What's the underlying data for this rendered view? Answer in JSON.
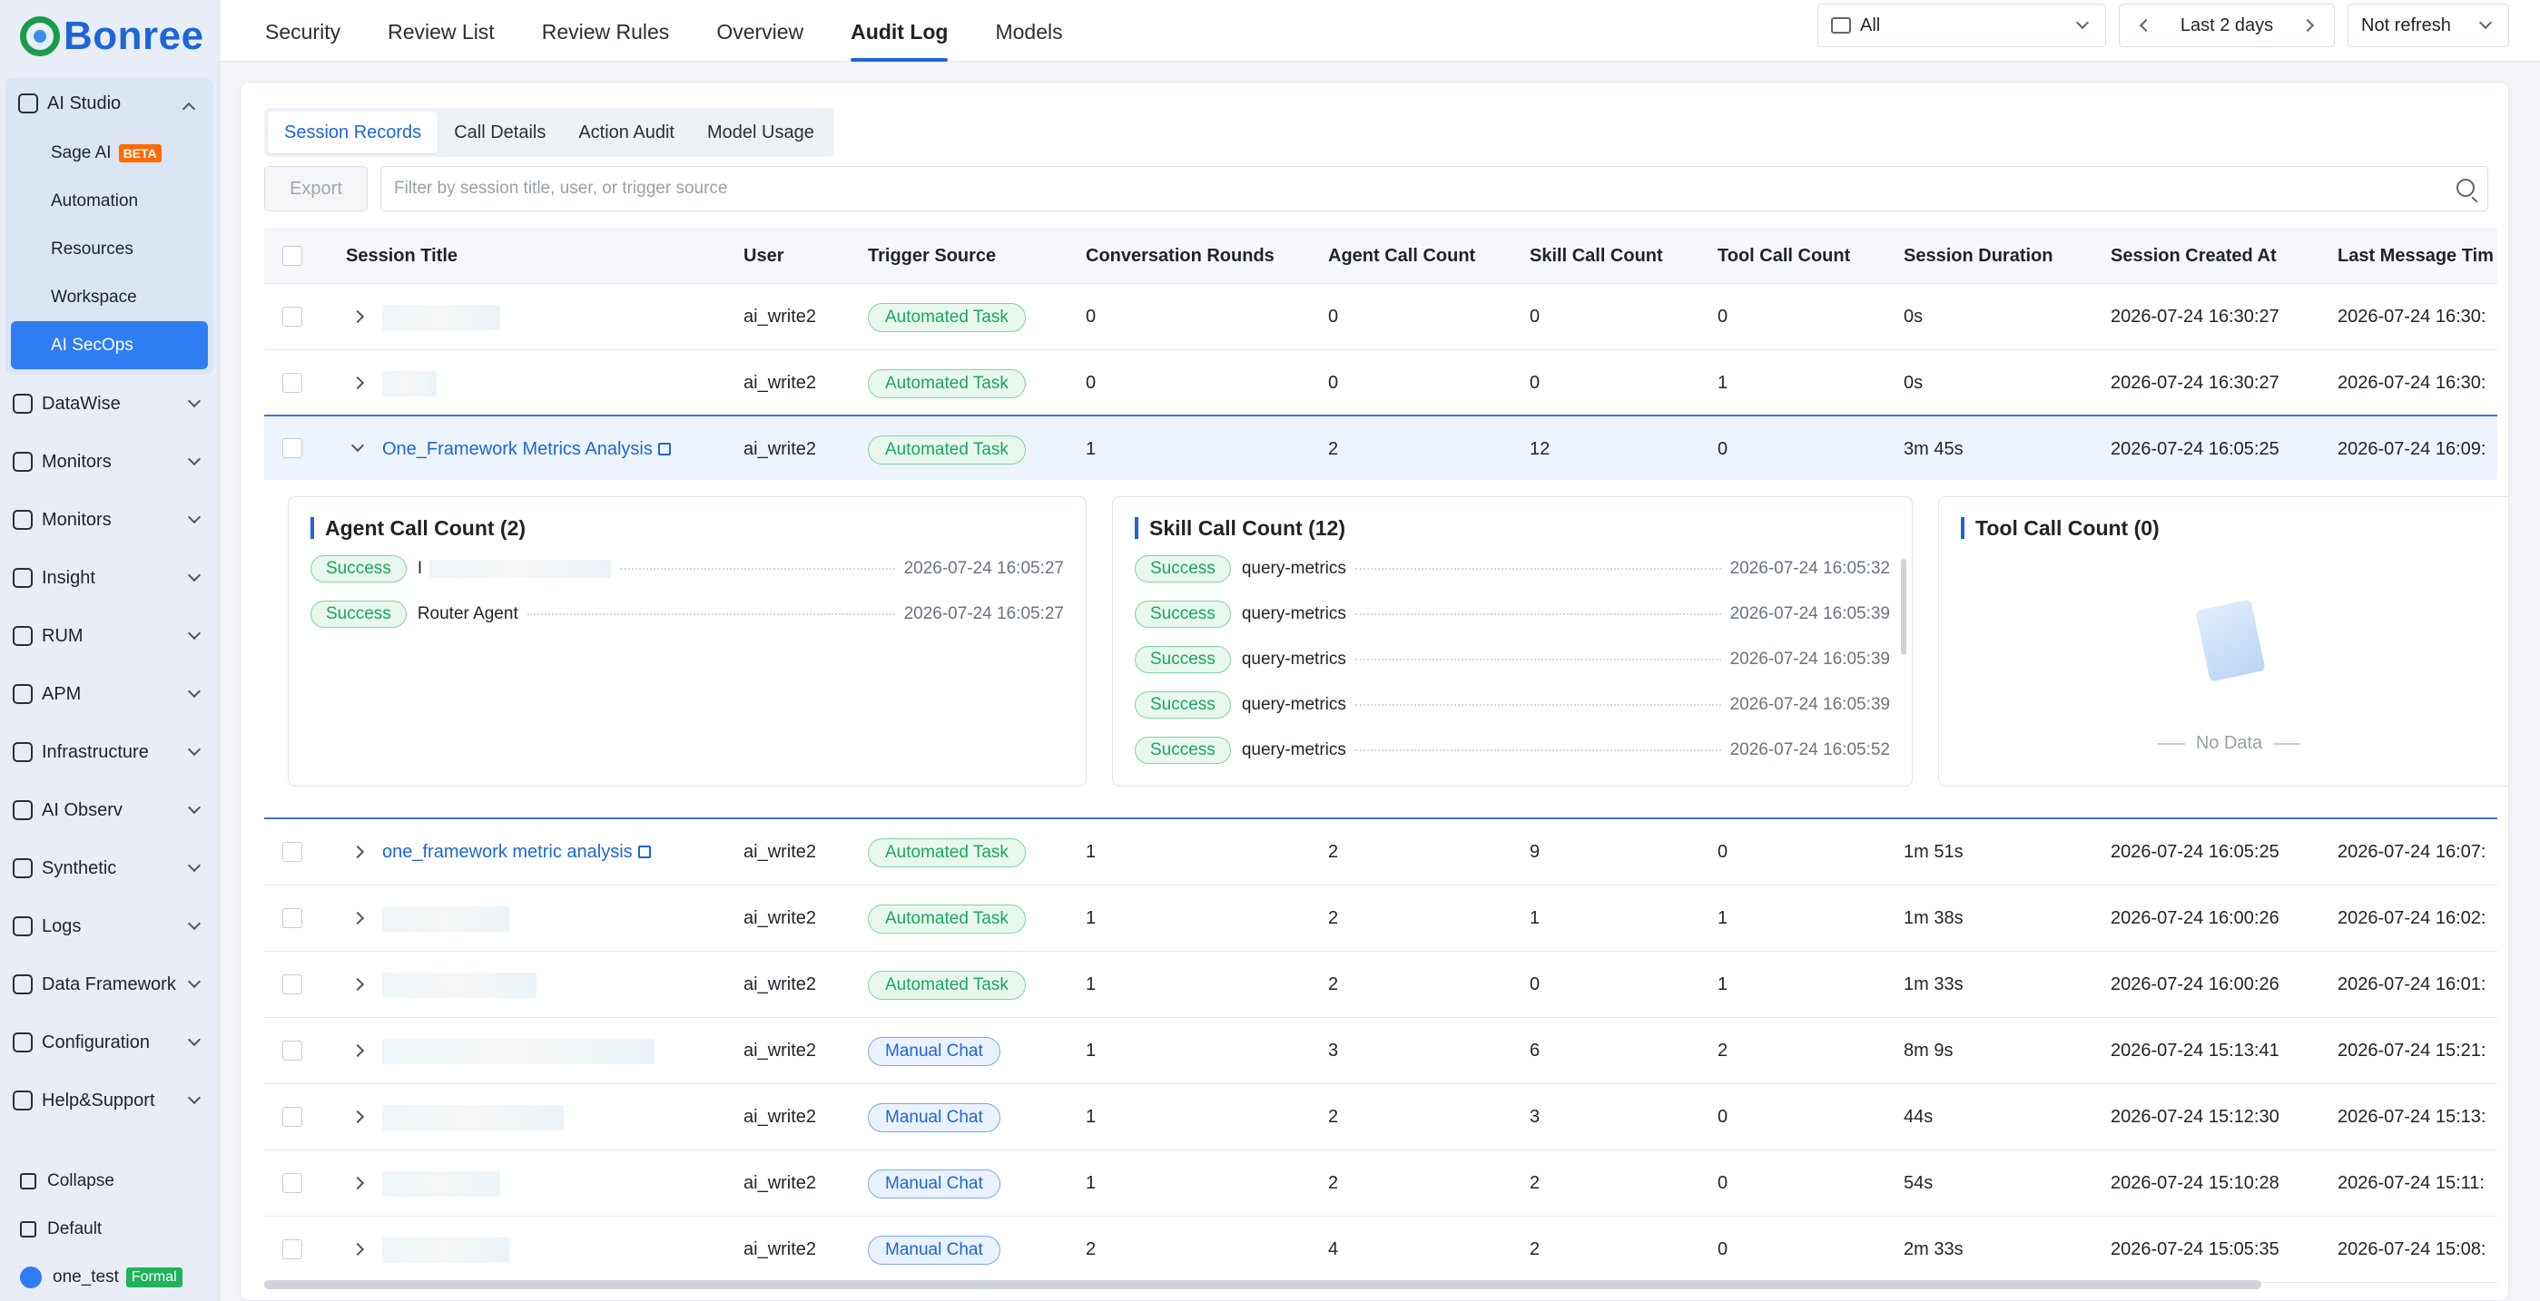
{
  "brand": {
    "name": "Bonree"
  },
  "sidebar": {
    "studio": {
      "label": "AI Studio"
    },
    "studio_items": [
      {
        "label": "Sage AI",
        "badge": "BETA"
      },
      {
        "label": "Automation"
      },
      {
        "label": "Resources"
      },
      {
        "label": "Workspace"
      },
      {
        "label": "AI SecOps"
      }
    ],
    "items": [
      {
        "label": "DataWise"
      },
      {
        "label": "Monitors"
      },
      {
        "label": "Monitors"
      },
      {
        "label": "Insight"
      },
      {
        "label": "RUM"
      },
      {
        "label": "APM"
      },
      {
        "label": "Infrastructure"
      },
      {
        "label": "AI Observ"
      },
      {
        "label": "Synthetic"
      },
      {
        "label": "Logs"
      },
      {
        "label": "Data Framework"
      },
      {
        "label": "Configuration"
      },
      {
        "label": "Help&Support"
      }
    ],
    "footer": {
      "collapse": "Collapse",
      "default": "Default",
      "user": "one_test",
      "user_badge": "Formal"
    }
  },
  "topbar": {
    "tabs": [
      "Security",
      "Review List",
      "Review Rules",
      "Overview",
      "Audit Log",
      "Models"
    ],
    "active_tab": "Audit Log",
    "filter_value": "All",
    "time_range": "Last 2 days",
    "refresh": "Not refresh"
  },
  "subtabs": [
    "Session Records",
    "Call Details",
    "Action Audit",
    "Model Usage"
  ],
  "toolbar": {
    "export": "Export",
    "filter_placeholder": "Filter by session title, user, or trigger source"
  },
  "table": {
    "columns": [
      "Session Title",
      "User",
      "Trigger Source",
      "Conversation Rounds",
      "Agent Call Count",
      "Skill Call Count",
      "Tool Call Count",
      "Session Duration",
      "Session Created At",
      "Last Message Tim"
    ],
    "rows": [
      {
        "title": "",
        "user": "ai_write2",
        "source": "Automated Task",
        "rounds": "0",
        "agent": "0",
        "skill": "0",
        "tool": "0",
        "duration": "0s",
        "created": "2026-07-24 16:30:27",
        "last": "2026-07-24 16:30:"
      },
      {
        "title": "",
        "user": "ai_write2",
        "source": "Automated Task",
        "rounds": "0",
        "agent": "0",
        "skill": "0",
        "tool": "1",
        "duration": "0s",
        "created": "2026-07-24 16:30:27",
        "last": "2026-07-24 16:30:"
      },
      {
        "title": "One_Framework Metrics Analysis",
        "user": "ai_write2",
        "source": "Automated Task",
        "rounds": "1",
        "agent": "2",
        "skill": "12",
        "tool": "0",
        "duration": "3m 45s",
        "created": "2026-07-24 16:05:25",
        "last": "2026-07-24 16:09:"
      },
      {
        "title": "one_framework metric analysis",
        "user": "ai_write2",
        "source": "Automated Task",
        "rounds": "1",
        "agent": "2",
        "skill": "9",
        "tool": "0",
        "duration": "1m 51s",
        "created": "2026-07-24 16:05:25",
        "last": "2026-07-24 16:07:"
      },
      {
        "title": "",
        "user": "ai_write2",
        "source": "Automated Task",
        "rounds": "1",
        "agent": "2",
        "skill": "1",
        "tool": "1",
        "duration": "1m 38s",
        "created": "2026-07-24 16:00:26",
        "last": "2026-07-24 16:02:"
      },
      {
        "title": "",
        "user": "ai_write2",
        "source": "Automated Task",
        "rounds": "1",
        "agent": "2",
        "skill": "0",
        "tool": "1",
        "duration": "1m 33s",
        "created": "2026-07-24 16:00:26",
        "last": "2026-07-24 16:01:"
      },
      {
        "title": "",
        "user": "ai_write2",
        "source": "Manual Chat",
        "rounds": "1",
        "agent": "3",
        "skill": "6",
        "tool": "2",
        "duration": "8m 9s",
        "created": "2026-07-24 15:13:41",
        "last": "2026-07-24 15:21:"
      },
      {
        "title": "",
        "user": "ai_write2",
        "source": "Manual Chat",
        "rounds": "1",
        "agent": "2",
        "skill": "3",
        "tool": "0",
        "duration": "44s",
        "created": "2026-07-24 15:12:30",
        "last": "2026-07-24 15:13:"
      },
      {
        "title": "",
        "user": "ai_write2",
        "source": "Manual Chat",
        "rounds": "1",
        "agent": "2",
        "skill": "2",
        "tool": "0",
        "duration": "54s",
        "created": "2026-07-24 15:10:28",
        "last": "2026-07-24 15:11:"
      },
      {
        "title": "",
        "user": "ai_write2",
        "source": "Manual Chat",
        "rounds": "2",
        "agent": "4",
        "skill": "2",
        "tool": "0",
        "duration": "2m 33s",
        "created": "2026-07-24 15:05:35",
        "last": "2026-07-24 15:08:"
      }
    ]
  },
  "detail": {
    "agent": {
      "title": "Agent Call Count (2)",
      "items": [
        {
          "status": "Success",
          "name": "I",
          "time": "2026-07-24 16:05:27"
        },
        {
          "status": "Success",
          "name": "Router Agent",
          "time": "2026-07-24 16:05:27"
        }
      ]
    },
    "skill": {
      "title": "Skill Call Count (12)",
      "items": [
        {
          "status": "Success",
          "name": "query-metrics",
          "time": "2026-07-24 16:05:32"
        },
        {
          "status": "Success",
          "name": "query-metrics",
          "time": "2026-07-24 16:05:39"
        },
        {
          "status": "Success",
          "name": "query-metrics",
          "time": "2026-07-24 16:05:39"
        },
        {
          "status": "Success",
          "name": "query-metrics",
          "time": "2026-07-24 16:05:39"
        },
        {
          "status": "Success",
          "name": "query-metrics",
          "time": "2026-07-24 16:05:52"
        }
      ]
    },
    "tool": {
      "title": "Tool Call Count (0)",
      "empty": "No Data"
    }
  }
}
